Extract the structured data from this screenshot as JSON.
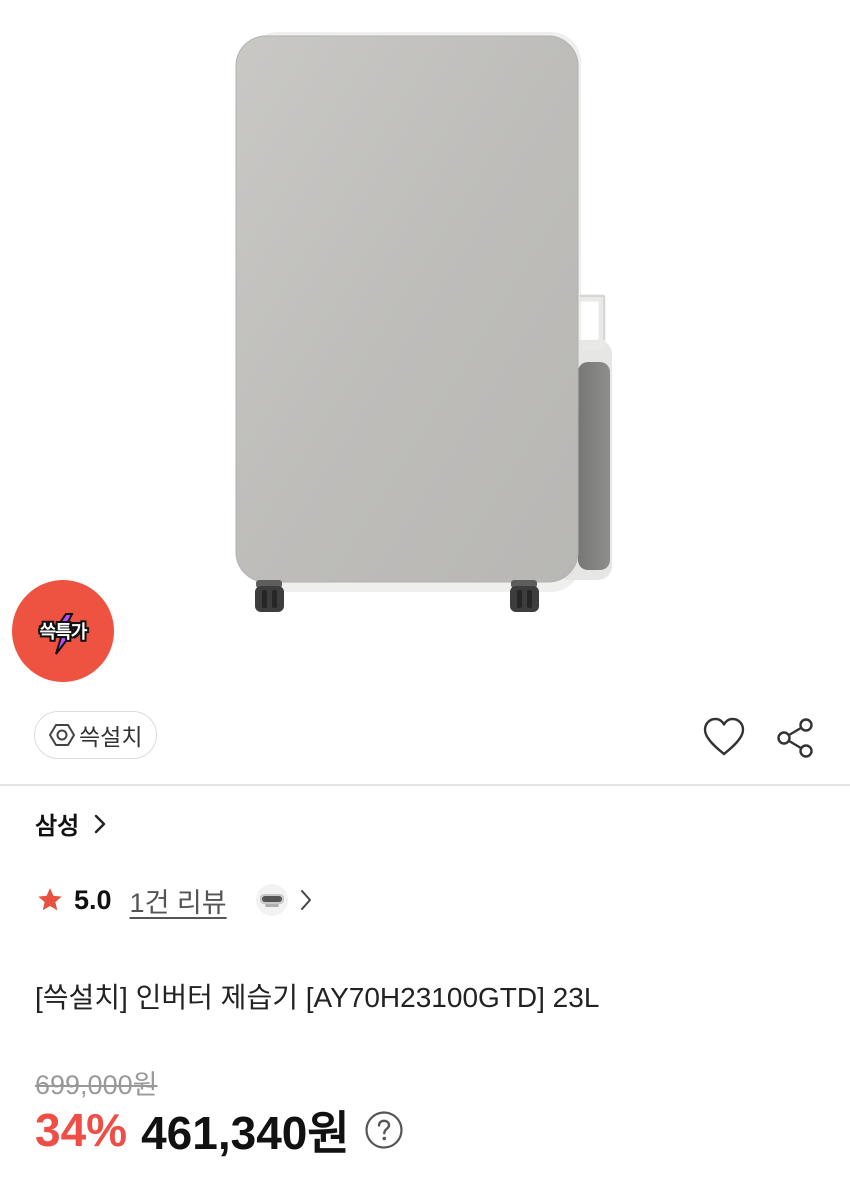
{
  "product_image": {
    "alt": ""
  },
  "promo_badge": {
    "text": "쓱특가",
    "color": "#ee5240"
  },
  "install_chip": {
    "icon": "gear-hexagon-icon",
    "label": "쓱설치"
  },
  "actions": {
    "wishlist_icon": "heart-icon",
    "share_icon": "share-icon"
  },
  "brand": {
    "name": "삼성",
    "icon": "chevron-right-icon"
  },
  "rating": {
    "icon": "star-icon",
    "score": "5.0",
    "reviews": "1건 리뷰",
    "star_color": "#e8503f"
  },
  "product": {
    "title": "[쓱설치] 인버터 제습기 [AY70H23100GTD] 23L"
  },
  "pricing": {
    "original": "699,000원",
    "discount": "34%",
    "price": "461,340원",
    "help_icon": "question-circle-icon",
    "discount_color": "#ee4e46"
  }
}
